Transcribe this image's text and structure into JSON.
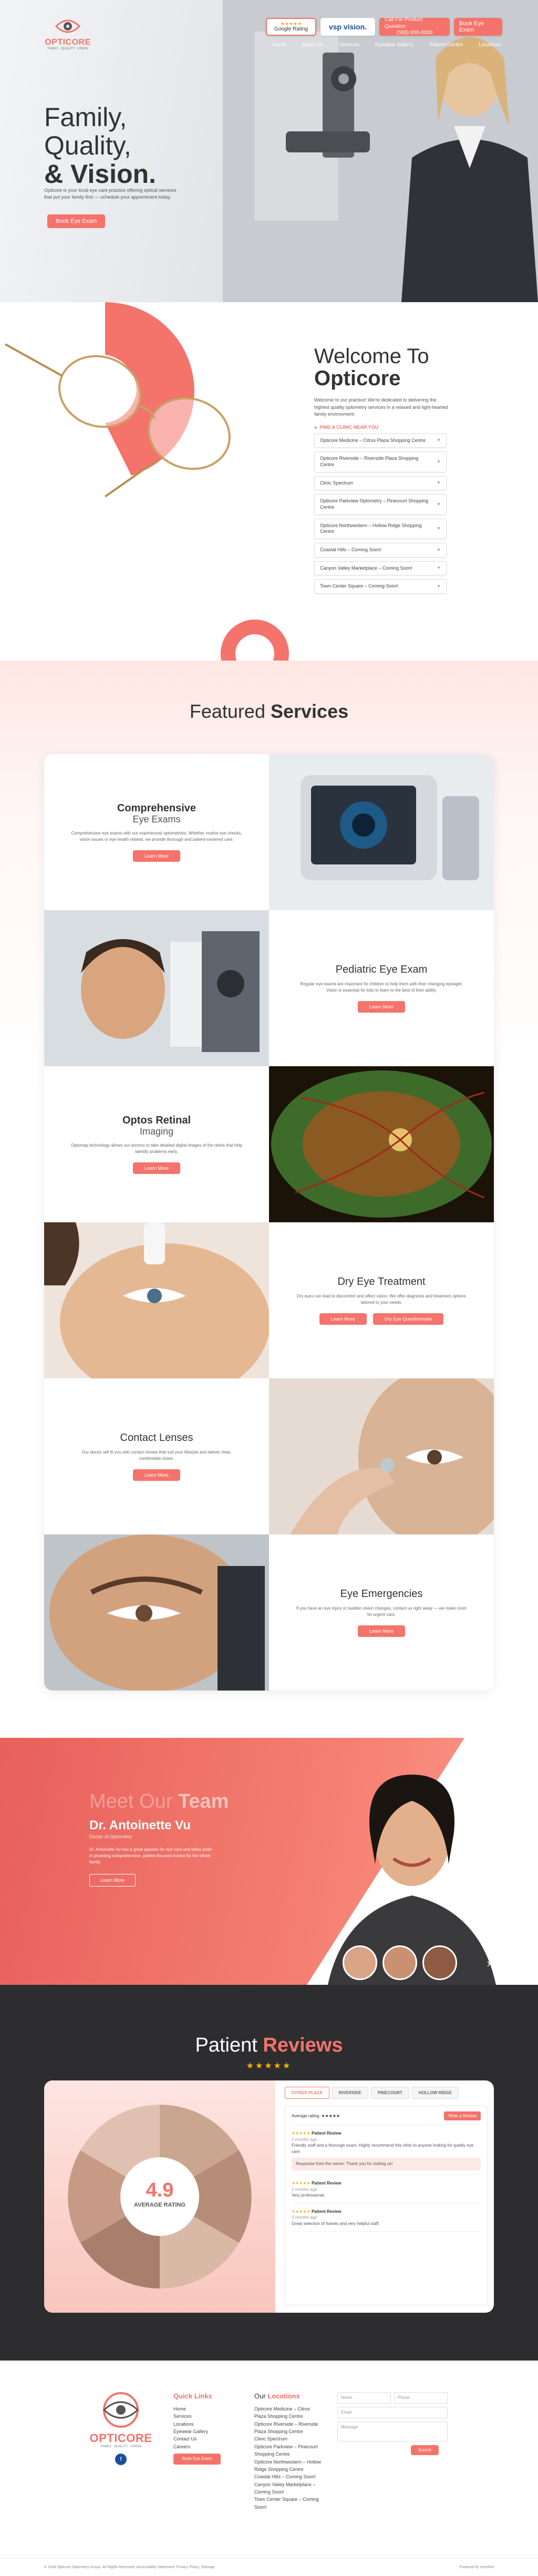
{
  "brand": {
    "name": "OPTICORE",
    "tagline": "FAMILY · QUALITY · VISION",
    "accent": "#f4736b"
  },
  "header": {
    "google": {
      "stars": "★★★★★",
      "label": "Google Rating"
    },
    "vsp": "vsp vision.",
    "call": {
      "line1": "Call For Product Question",
      "line2": "(555) 000-0000"
    },
    "book": "Book Eye Exam",
    "nav": [
      "Home",
      "About Us",
      "Services",
      "Eyewear Gallery",
      "Patient Centre",
      "Locations"
    ]
  },
  "hero": {
    "title_line1": "Family,",
    "title_line2": "Quality,",
    "title_line3": "& Vision.",
    "subtitle": "Opticore is your local eye care practice offering optical services that put your family first — schedule your appointment today.",
    "cta": "Book Eye Exam"
  },
  "welcome": {
    "title_line1": "Welcome To",
    "title_line2": "Opticore",
    "body": "Welcome to our practice! We're dedicated to delivering the highest quality optometry services in a relaxed and light-hearted family environment.",
    "locations_label": "FIND A CLINIC NEAR YOU",
    "locations": [
      "Opticore Medicine – Citrus Plaza Shopping Centre",
      "Opticore Riverside – Riverside Plaza Shopping Centre",
      "Clinic Spectrum",
      "Opticore Parkview Optometry – Pinecourt Shopping Centre",
      "Opticore Northwestern – Hollow Ridge Shopping Centre",
      "Coastal Hills – Coming Soon!",
      "Canyon Valley Marketplace – Coming Soon!",
      "Town Center Square – Coming Soon!"
    ]
  },
  "services": {
    "title_light": "Featured",
    "title_bold": "Services",
    "items": [
      {
        "title_bold": "Comprehensive",
        "title_light": "Eye Exams",
        "desc": "Comprehensive eye exams with our experienced optometrists. Whether routine eye checks, vision issues or eye health related, we provide thorough and patient-centered care.",
        "buttons": [
          "Learn More"
        ]
      },
      {
        "title_bold": "Pediatric Eye",
        "title_light": "Exam",
        "desc": "Regular eye exams are important for children to help them with their changing eyesight. Vision is essential for kids to learn to the best of their ability.",
        "buttons": [
          "Learn More"
        ]
      },
      {
        "title_bold": "Optos Retinal",
        "title_light": "Imaging",
        "desc": "Optomap technology allows our doctors to take detailed digital images of the retina that help identify problems early.",
        "buttons": [
          "Learn More"
        ]
      },
      {
        "title_bold": "Dry Eye",
        "title_light": "Treatment",
        "desc": "Dry eyes can lead to discomfort and affect vision. We offer diagnosis and treatment options tailored to your needs.",
        "buttons": [
          "Learn More",
          "Dry Eye Questionnaire"
        ]
      },
      {
        "title_bold": "Contact",
        "title_light": "Lenses",
        "desc": "Our doctor will fit you with contact lenses that suit your lifestyle and deliver clear, comfortable vision.",
        "buttons": [
          "Learn More"
        ]
      },
      {
        "title_bold": "Eye",
        "title_light": "Emergencies",
        "desc": "If you have an eye injury or sudden vision changes, contact us right away — we make room for urgent care.",
        "buttons": [
          "Learn More"
        ]
      }
    ]
  },
  "team": {
    "title_light": "Meet Our",
    "title_bold": "Team",
    "name": "Dr. Antoinette Vu",
    "role": "Doctor of Optometry",
    "bio": "Dr. Antoinette Vu has a great passion for eye care and takes pride in providing comprehensive, patient-focused exams for the whole family.",
    "cta": "Learn More",
    "arrow": "›"
  },
  "reviews": {
    "title_light": "Patient",
    "title_bold": "Reviews",
    "stars": "★★★★★",
    "rating": "4.9",
    "rating_label": "AVERAGE RATING",
    "tabs": [
      "CITRUS PLAZA",
      "RIVERSIDE",
      "PINECOURT",
      "HOLLOW RIDGE"
    ],
    "summary": "Average rating: ★★★★★",
    "write": "Write a Review",
    "items": [
      {
        "stars": "★★★★★",
        "who": "Patient Review",
        "date": "2 months ago",
        "text": "Friendly staff and a thorough exam. Highly recommend this clinic to anyone looking for quality eye care.",
        "reply": "Response from the owner: Thank you for visiting us!"
      },
      {
        "stars": "★★★★★",
        "who": "Patient Review",
        "date": "2 months ago",
        "text": "Very professional.",
        "reply": ""
      },
      {
        "stars": "★★★★★",
        "who": "Patient Review",
        "date": "3 months ago",
        "text": "Great selection of frames and very helpful staff.",
        "reply": ""
      }
    ]
  },
  "footer": {
    "quick_title_light": "Quick",
    "quick_title_bold": "Links",
    "quick_links": [
      "Home",
      "Services",
      "Locations",
      "Eyewear Gallery",
      "Contact Us",
      "Careers"
    ],
    "book": "Book Eye Exam",
    "locations_title_light": "Our",
    "locations_title_bold": "Locations",
    "locations": [
      "Opticore Medicine – Citrus Plaza Shopping Centre",
      "Opticore Riverside – Riverside Plaza Shopping Centre",
      "Clinic Spectrum",
      "Opticore Parkview – Pinecourt Shopping Centre",
      "Opticore Northwestern – Hollow Ridge Shopping Centre",
      "Coastal Hills – Coming Soon!",
      "Canyon Valley Marketplace – Coming Soon!",
      "Town Center Square – Coming Soon!"
    ],
    "form": {
      "name": "Name",
      "phone": "Phone",
      "email": "Email",
      "message": "Message",
      "submit": "Submit"
    },
    "social_facebook": "f",
    "copyright": "© 2024 Opticore Optometry Group. All Rights Reserved. Accessibility Statement. Privacy Policy. Sitemap.",
    "credit": "Powered by rlevelnet"
  }
}
